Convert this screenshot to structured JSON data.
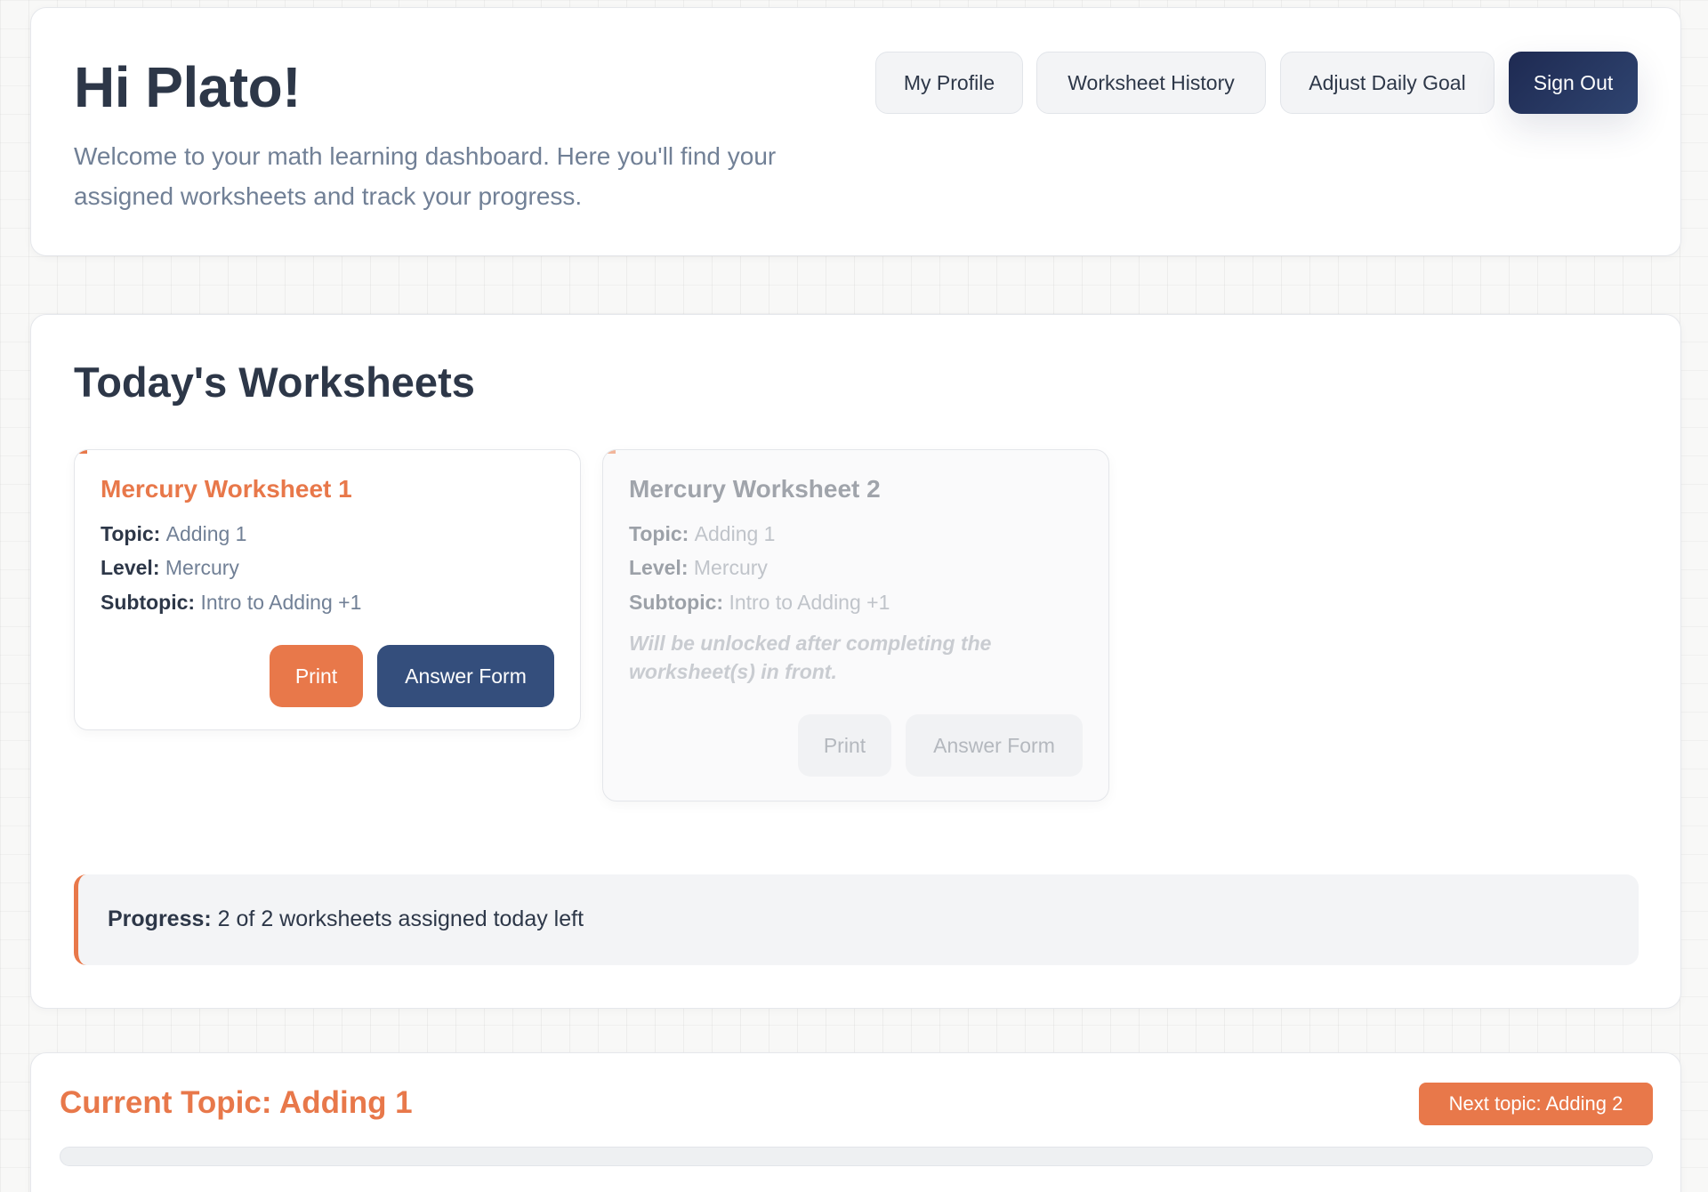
{
  "header": {
    "greeting": "Hi Plato!",
    "welcome": "Welcome to your math learning dashboard. Here you'll find your assigned worksheets and track your progress.",
    "nav": {
      "profile": "My Profile",
      "history": "Worksheet History",
      "goal": "Adjust Daily Goal",
      "signout": "Sign Out"
    }
  },
  "worksheets": {
    "title": "Today's Worksheets",
    "labels": {
      "topic": "Topic:",
      "level": "Level:",
      "subtopic": "Subtopic:"
    },
    "items": [
      {
        "title": "Mercury Worksheet 1",
        "topic": "Adding 1",
        "level": "Mercury",
        "subtopic": "Intro to Adding +1",
        "print": "Print",
        "answer": "Answer Form",
        "locked": false
      },
      {
        "title": "Mercury Worksheet 2",
        "topic": "Adding 1",
        "level": "Mercury",
        "subtopic": "Intro to Adding +1",
        "note": "Will be unlocked after completing the worksheet(s) in front.",
        "print": "Print",
        "answer": "Answer Form",
        "locked": true
      }
    ],
    "progress": {
      "label": "Progress:",
      "text": "2 of 2 worksheets assigned today left"
    }
  },
  "topic": {
    "title": "Current Topic: Adding 1",
    "next": "Next topic: Adding 2",
    "progress_fraction": 0
  },
  "colors": {
    "accent": "#e8784a",
    "navy": "#1e2a52",
    "answer_button": "#344e7c",
    "text": "#2d3748",
    "muted": "#718096"
  }
}
